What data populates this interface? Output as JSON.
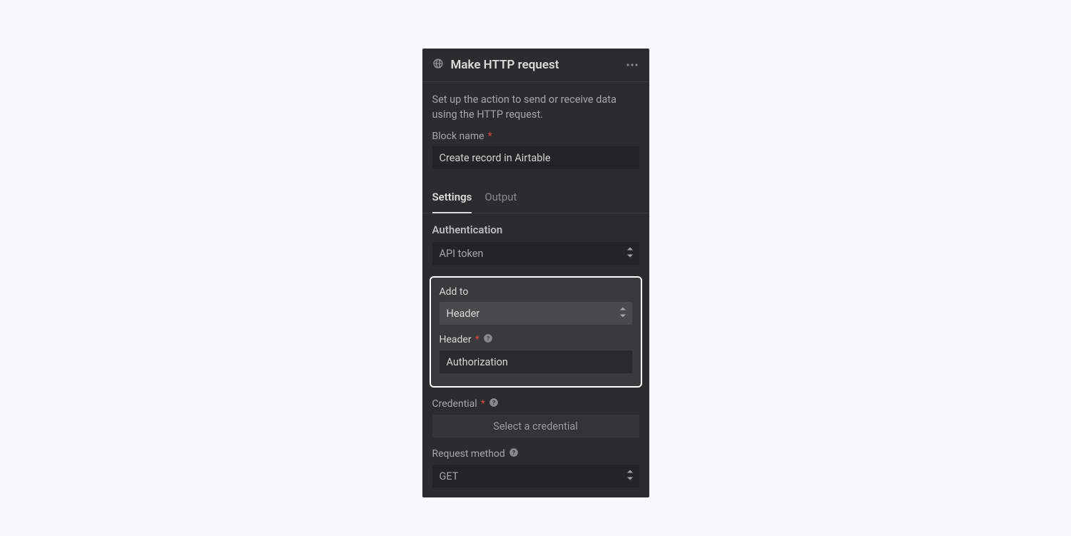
{
  "header": {
    "title": "Make HTTP request"
  },
  "description": "Set up the action to send or receive data using the HTTP request.",
  "block_name": {
    "label": "Block name",
    "value": "Create record in Airtable"
  },
  "tabs": {
    "settings": "Settings",
    "output": "Output"
  },
  "auth": {
    "section_label": "Authentication",
    "mode_value": "API token",
    "add_to": {
      "label": "Add to",
      "value": "Header"
    },
    "header_field": {
      "label": "Header",
      "value": "Authorization"
    },
    "credential": {
      "label": "Credential",
      "button": "Select a credential"
    }
  },
  "request_method": {
    "label": "Request method",
    "value": "GET"
  }
}
